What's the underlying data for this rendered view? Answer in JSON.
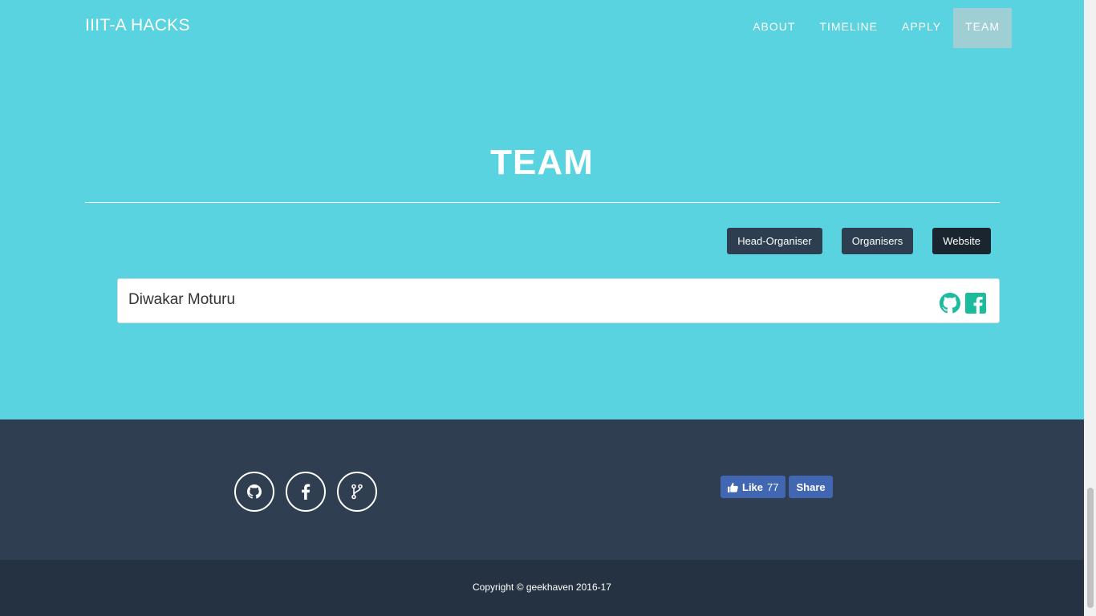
{
  "nav": {
    "brand": "IIIT-A HACKS",
    "items": [
      {
        "label": "ABOUT",
        "active": false
      },
      {
        "label": "TIMELINE",
        "active": false
      },
      {
        "label": "APPLY",
        "active": false
      },
      {
        "label": "TEAM",
        "active": true
      }
    ]
  },
  "team": {
    "title": "TEAM",
    "filters": [
      "Head-Organiser",
      "Organisers",
      "Website"
    ],
    "members": [
      {
        "name": "Diwakar Moturu",
        "icons": [
          "github-icon",
          "facebook-icon"
        ]
      }
    ]
  },
  "footer": {
    "social_icons": [
      "github-icon",
      "facebook-icon",
      "git-branch-icon"
    ],
    "fb_like_label": "Like",
    "fb_like_count": "77",
    "fb_share_label": "Share",
    "copyright": "Copyright © geekhaven 2016-17"
  },
  "colors": {
    "hero_bg": "#5ad3e0",
    "footer_bg": "#2f3e50",
    "copyright_bg": "#253241",
    "accent_green": "#1abc9c",
    "facebook_blue": "#4267b2"
  }
}
